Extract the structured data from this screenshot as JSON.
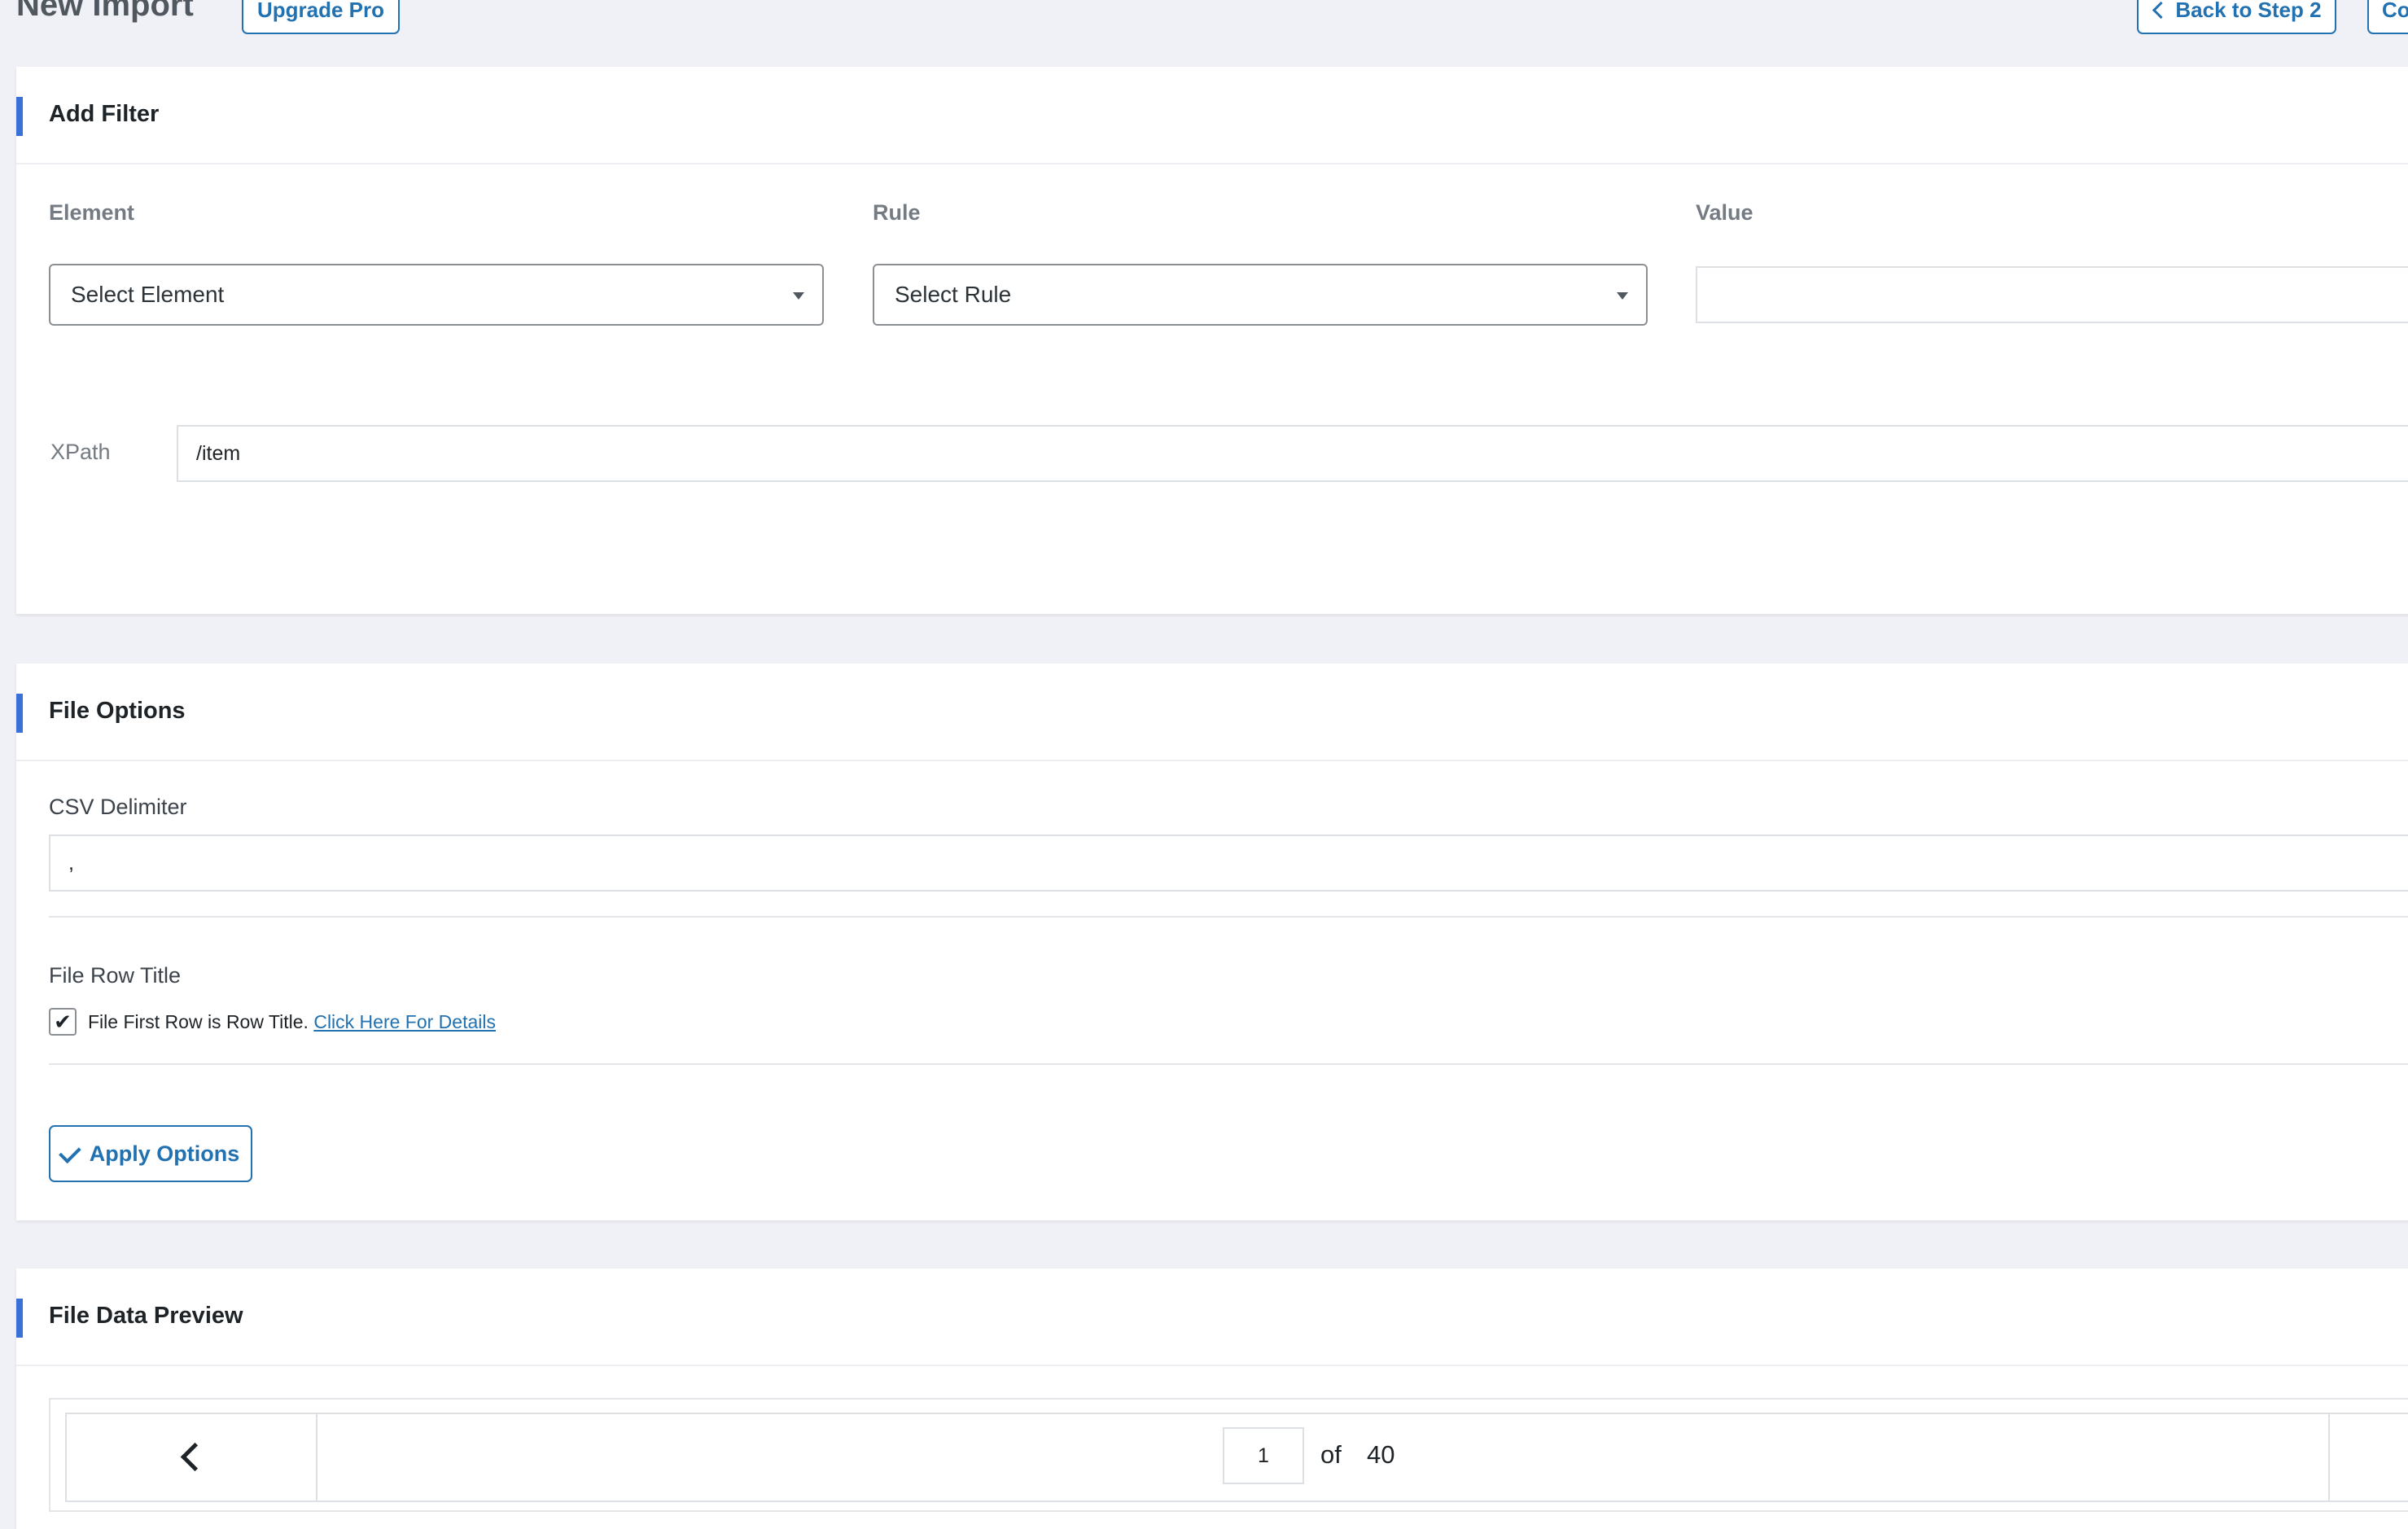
{
  "header": {
    "title": "New Import",
    "upgrade_label": "Upgrade Pro",
    "back_label": "Back to Step 2",
    "continue_label": "Co"
  },
  "add_filter": {
    "title": "Add Filter",
    "element_label": "Element",
    "element_value": "Select Element",
    "rule_label": "Rule",
    "rule_value": "Select Rule",
    "value_label": "Value",
    "value_value": "",
    "xpath_label": "XPath",
    "xpath_value": "/item"
  },
  "file_options": {
    "title": "File Options",
    "csv_delimiter_label": "CSV Delimiter",
    "csv_delimiter_value": ",",
    "row_title_label": "File Row Title",
    "row_title_checkbox_text": "File First Row is Row Title.",
    "row_title_checked": true,
    "details_link": "Click Here For Details",
    "apply_label": "Apply Options"
  },
  "preview": {
    "title": "File Data Preview",
    "page_current": "1",
    "page_of": "of",
    "page_total": "40"
  },
  "colors": {
    "accent": "#3a71d7",
    "link": "#2271b1",
    "background": "#f0f1f6"
  }
}
